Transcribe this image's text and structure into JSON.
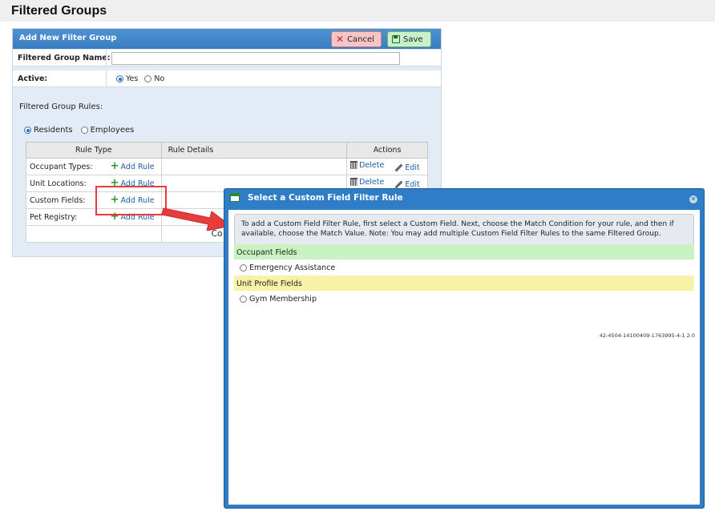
{
  "page": {
    "title": "Filtered Groups"
  },
  "panel": {
    "title": "Add New Filter Group",
    "cancel_label": "Cancel",
    "save_label": "Save",
    "group_name_label": "Filtered Group Name:",
    "group_name_value": "",
    "active_label": "Active:",
    "active_yes": "Yes",
    "active_no": "No",
    "rules_heading": "Filtered Group Rules:",
    "scope_residents": "Residents",
    "scope_employees": "Employees"
  },
  "rules_table": {
    "headers": [
      "Rule Type",
      "Rule Details",
      "Actions"
    ],
    "rows": [
      {
        "label": "Occupant Types:",
        "add": "Add Rule",
        "delete": "Delete",
        "edit": "Edit"
      },
      {
        "label": "Unit Locations:",
        "add": "Add Rule",
        "delete": "Delete",
        "edit": "Edit"
      },
      {
        "label": "Custom Fields:",
        "add": "Add Rule"
      },
      {
        "label": "Pet Registry:",
        "add": "Add Rule"
      }
    ],
    "footer_partial": "Co"
  },
  "dialog": {
    "title": "Select a Custom Field Filter Rule",
    "instructions": "To add a Custom Field Filter Rule, first select a Custom Field. Next, choose the Match Condition for your rule, and then if available, choose the Match Value. Note: You may add multiple Custom Field Filter Rules to the same Filtered Group.",
    "occupant_section": "Occupant Fields",
    "occupant_option": "Emergency Assistance",
    "unit_section": "Unit Profile Fields",
    "unit_option": "Gym Membership",
    "version": "42-4504-14100409-1763995-4-1 2.0"
  },
  "colors": {
    "header_blue": "#3a7cc0",
    "annotation_red": "#e83c3c",
    "occupant_green": "#c8f2c0",
    "unit_yellow": "#f7f2a5"
  }
}
